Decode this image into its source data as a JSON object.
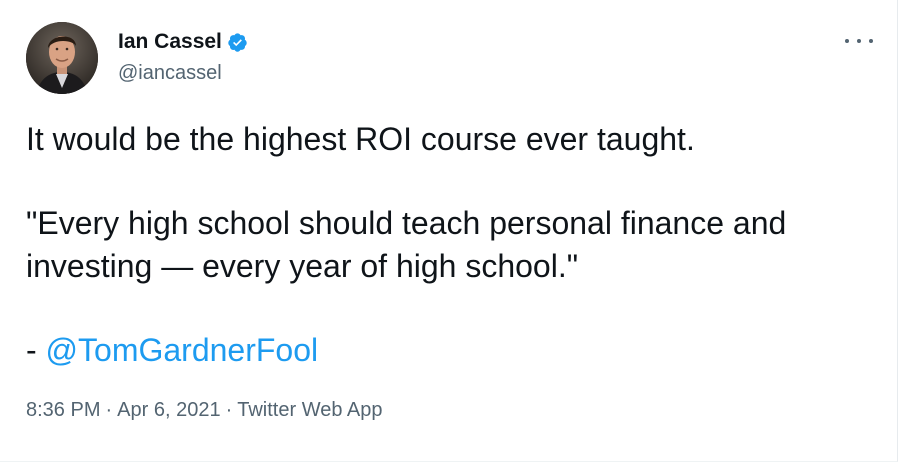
{
  "author": {
    "display_name": "Ian Cassel",
    "handle": "@iancassel",
    "verified": true
  },
  "tweet": {
    "line1": "It would be the highest ROI course ever taught.",
    "quote_line1": "\"Every high school should teach personal finance and",
    "quote_line2": "investing — every year of high school.\"",
    "dash_prefix": "- ",
    "mention": "@TomGardnerFool"
  },
  "meta": {
    "time": "8:36 PM",
    "separator": "·",
    "date": "Apr 6, 2021",
    "source": "Twitter Web App"
  },
  "icons": {
    "verified": "verified-badge-icon",
    "more": "more-options-icon"
  },
  "colors": {
    "link": "#1d9bf0",
    "secondary_text": "#536471",
    "primary_text": "#0f1419"
  }
}
